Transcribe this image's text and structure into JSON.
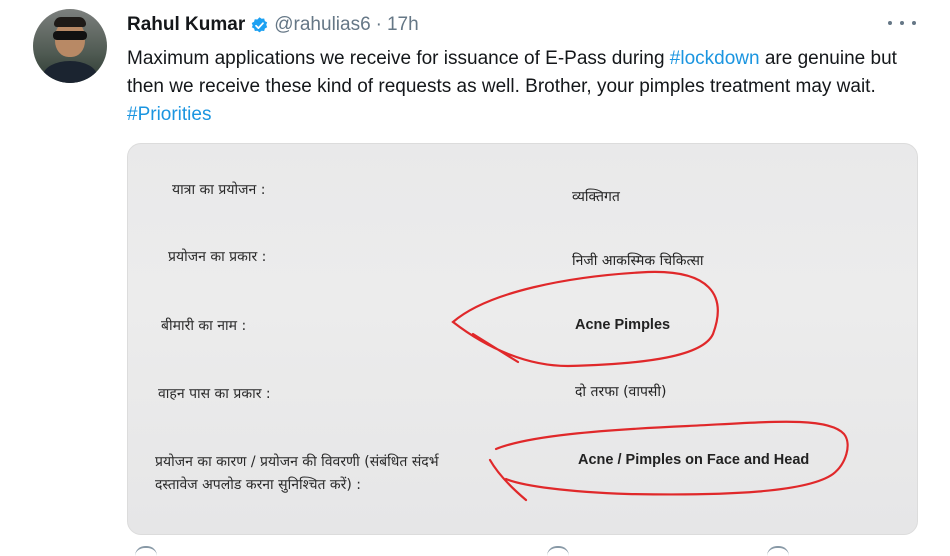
{
  "tweet": {
    "author": {
      "name": "Rahul Kumar",
      "handle": "@rahulias6",
      "separator": "·",
      "time": "17h",
      "verified": true,
      "avatar_icon": "user-avatar"
    },
    "text_parts": {
      "p1": "Maximum applications we receive for issuance of E-Pass during ",
      "hashtag1": "#lockdown",
      "p2": " are genuine but then we receive these kind of requests as well. Brother, your pimples treatment may wait. ",
      "hashtag2": "#Priorities"
    },
    "colors": {
      "link": "#1b95e0",
      "text": "#14171a",
      "muted": "#657786",
      "marker": "#e0282a"
    }
  },
  "document": {
    "rows": [
      {
        "label": "यात्रा का प्रयोजन :",
        "value": "व्यक्तिगत"
      },
      {
        "label": "प्रयोजन का प्रकार :",
        "value": "निजी आकस्मिक चिकित्सा"
      },
      {
        "label": "बीमारी का नाम :",
        "value": "Acne Pimples"
      },
      {
        "label": "वाहन पास का प्रकार :",
        "value": "दो तरफा (वापसी)"
      },
      {
        "label_line1": "प्रयोजन का कारण / प्रयोजन की विवरणी (संबंधित संदर्भ",
        "label_line2": "दस्तावेज अपलोड करना सुनिश्चित करें) :",
        "value": "Acne / Pimples on Face and Head"
      }
    ]
  }
}
